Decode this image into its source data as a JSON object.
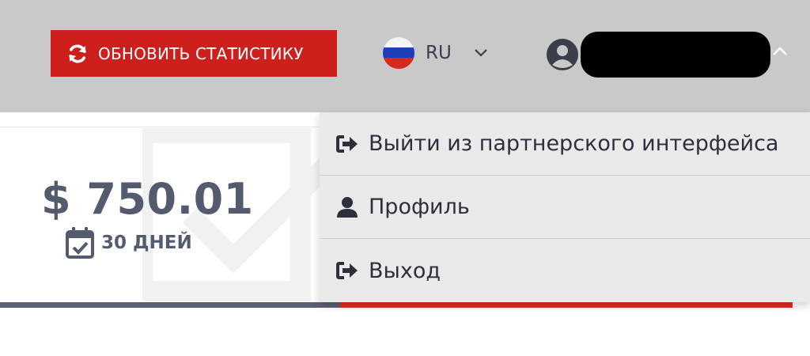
{
  "header": {
    "refresh_button": {
      "label": "ОБНОВИТЬ СТАТИСТИКУ",
      "icon": "refresh-icon",
      "color": "#cd1f1c"
    },
    "language": {
      "code": "RU",
      "flag_icon": "russia-flag-icon",
      "chevron_icon": "chevron-down-icon"
    },
    "user": {
      "avatar_icon": "user-circle-icon",
      "chevron_icon": "chevron-up-icon"
    }
  },
  "stat_card": {
    "amount": "$ 750.01",
    "period_label": "30 ДНЕЙ",
    "period_icon": "calendar-check-icon"
  },
  "dropdown": {
    "items": [
      {
        "label": "Выйти из партнерского интерфейса",
        "icon": "sign-out-icon"
      },
      {
        "label": "Профиль",
        "icon": "user-icon"
      },
      {
        "label": "Выход",
        "icon": "sign-out-icon"
      }
    ]
  },
  "colors": {
    "accent_red": "#e02b20",
    "header_bg": "#c9c9c9",
    "text_dark": "#555b6e"
  }
}
